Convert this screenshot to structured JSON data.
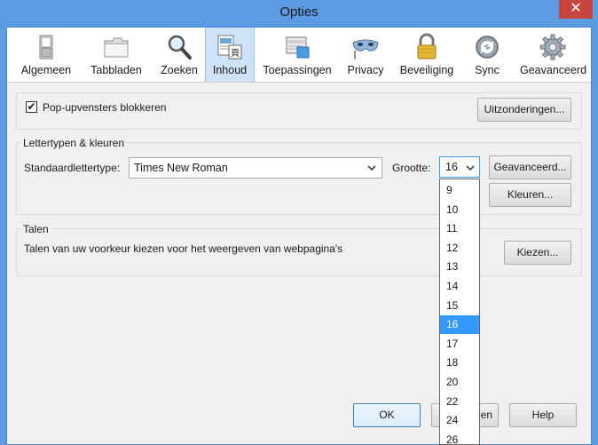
{
  "window": {
    "title": "Opties",
    "close_glyph": "✕"
  },
  "toolbar": {
    "items": [
      {
        "label": "Algemeen",
        "icon": "general-switch-icon"
      },
      {
        "label": "Tabbladen",
        "icon": "tabs-folder-icon"
      },
      {
        "label": "Zoeken",
        "icon": "magnifier-icon"
      },
      {
        "label": "Inhoud",
        "icon": "content-page-icon",
        "selected": true
      },
      {
        "label": "Toepassingen",
        "icon": "applications-icon"
      },
      {
        "label": "Privacy",
        "icon": "privacy-mask-icon"
      },
      {
        "label": "Beveiliging",
        "icon": "padlock-icon"
      },
      {
        "label": "Sync",
        "icon": "sync-icon"
      },
      {
        "label": "Geavanceerd",
        "icon": "gear-icon"
      }
    ]
  },
  "popups": {
    "checkbox_checked": true,
    "check_glyph": "✔",
    "label": "Pop-upvensters blokkeren",
    "exceptions_button": "Uitzonderingen..."
  },
  "fonts": {
    "group_label": "Lettertypen & kleuren",
    "default_font_label": "Standaardlettertype:",
    "default_font_value": "Times New Roman",
    "size_label": "Grootte:",
    "size_value": "16",
    "advanced_button": "Geavanceerd...",
    "colors_button": "Kleuren..."
  },
  "size_dropdown": {
    "options": [
      "9",
      "10",
      "11",
      "12",
      "13",
      "14",
      "15",
      "16",
      "17",
      "18",
      "20",
      "22",
      "24",
      "26"
    ],
    "selected": "16"
  },
  "languages": {
    "group_label": "Talen",
    "description": "Talen van uw voorkeur kiezen voor het weergeven van webpagina's",
    "choose_button": "Kiezen..."
  },
  "footer": {
    "ok_button": "OK",
    "cancel_button_partial": "en",
    "help_button": "Help"
  },
  "colors": {
    "titlebar": "#5b9be4",
    "selected_tab": "#cde3f7",
    "dropdown_highlight": "#3399ff",
    "close_button": "#c7453f"
  }
}
